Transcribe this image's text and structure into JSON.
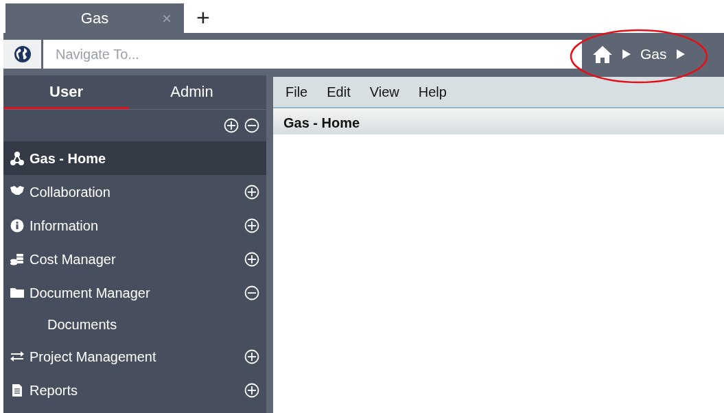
{
  "tabs": [
    {
      "label": "Gas",
      "close": "×",
      "selected": true
    }
  ],
  "new_tab": "+",
  "address_bar": {
    "placeholder": "Navigate To..."
  },
  "breadcrumb": [
    "Gas"
  ],
  "sidebar": {
    "tabs": [
      {
        "label": "User",
        "selected": true
      },
      {
        "label": "Admin",
        "selected": false
      }
    ],
    "items": [
      {
        "label": "Gas - Home",
        "selected": true
      },
      {
        "label": "Collaboration",
        "selected": false,
        "expanded": false
      },
      {
        "label": "Information",
        "selected": false,
        "expanded": false
      },
      {
        "label": "Cost Manager",
        "selected": false,
        "expanded": false
      },
      {
        "label": "Document Manager",
        "selected": false,
        "expanded": true,
        "children": [
          {
            "label": "Documents",
            "selected": false
          }
        ]
      },
      {
        "label": "Project Management",
        "selected": false,
        "expanded": false
      },
      {
        "label": "Reports",
        "selected": false,
        "expanded": false
      }
    ]
  },
  "menu": [
    "File",
    "Edit",
    "View",
    "Help"
  ],
  "page_title": "Gas - Home"
}
